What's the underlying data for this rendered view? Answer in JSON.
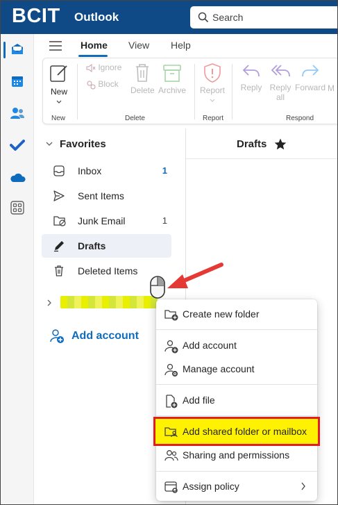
{
  "header": {
    "brand": "BCIT",
    "app_name": "Outlook",
    "search_placeholder": "Search"
  },
  "ribbon_tabs": [
    {
      "label": "Home"
    },
    {
      "label": "View"
    },
    {
      "label": "Help"
    }
  ],
  "ribbon": {
    "new_label": "New",
    "ignore_label": "Ignore",
    "block_label": "Block",
    "delete_label": "Delete",
    "archive_label": "Archive",
    "report_label": "Report",
    "reply_label": "Reply",
    "reply_all_label_1": "Reply",
    "reply_all_label_2": "all",
    "forward_label": "Forward",
    "more_label": "M",
    "groups": [
      "New",
      "Delete",
      "Report",
      "Respond"
    ]
  },
  "folders": {
    "favorites_label": "Favorites",
    "items": [
      {
        "label": "Inbox",
        "count": "1",
        "icon": "inbox-icon"
      },
      {
        "label": "Sent Items",
        "count": "",
        "icon": "send-icon"
      },
      {
        "label": "Junk Email",
        "count": "1",
        "icon": "junk-folder-icon"
      },
      {
        "label": "Drafts",
        "count": "",
        "icon": "pencil-icon"
      },
      {
        "label": "Deleted Items",
        "count": "",
        "icon": "trash-icon"
      }
    ],
    "add_account_label": "Add account"
  },
  "message_list": {
    "title": "Drafts"
  },
  "context_menu": {
    "items": [
      {
        "label": "Create new folder",
        "icon": "folder-add-icon"
      },
      {
        "label": "Add account",
        "icon": "person-add-icon"
      },
      {
        "label": "Manage account",
        "icon": "person-settings-icon"
      },
      {
        "label": "Add file",
        "icon": "file-add-icon"
      },
      {
        "label": "Add shared folder or mailbox",
        "icon": "folder-shared-icon"
      },
      {
        "label": "Sharing and permissions",
        "icon": "people-icon"
      },
      {
        "label": "Assign policy",
        "icon": "policy-icon"
      }
    ]
  },
  "colors": {
    "topbar": "#0F4A86",
    "accent": "#0F6CBD",
    "highlight": "#FFF200",
    "highlight_border": "#E0201E",
    "annotation_arrow": "#E53935"
  }
}
